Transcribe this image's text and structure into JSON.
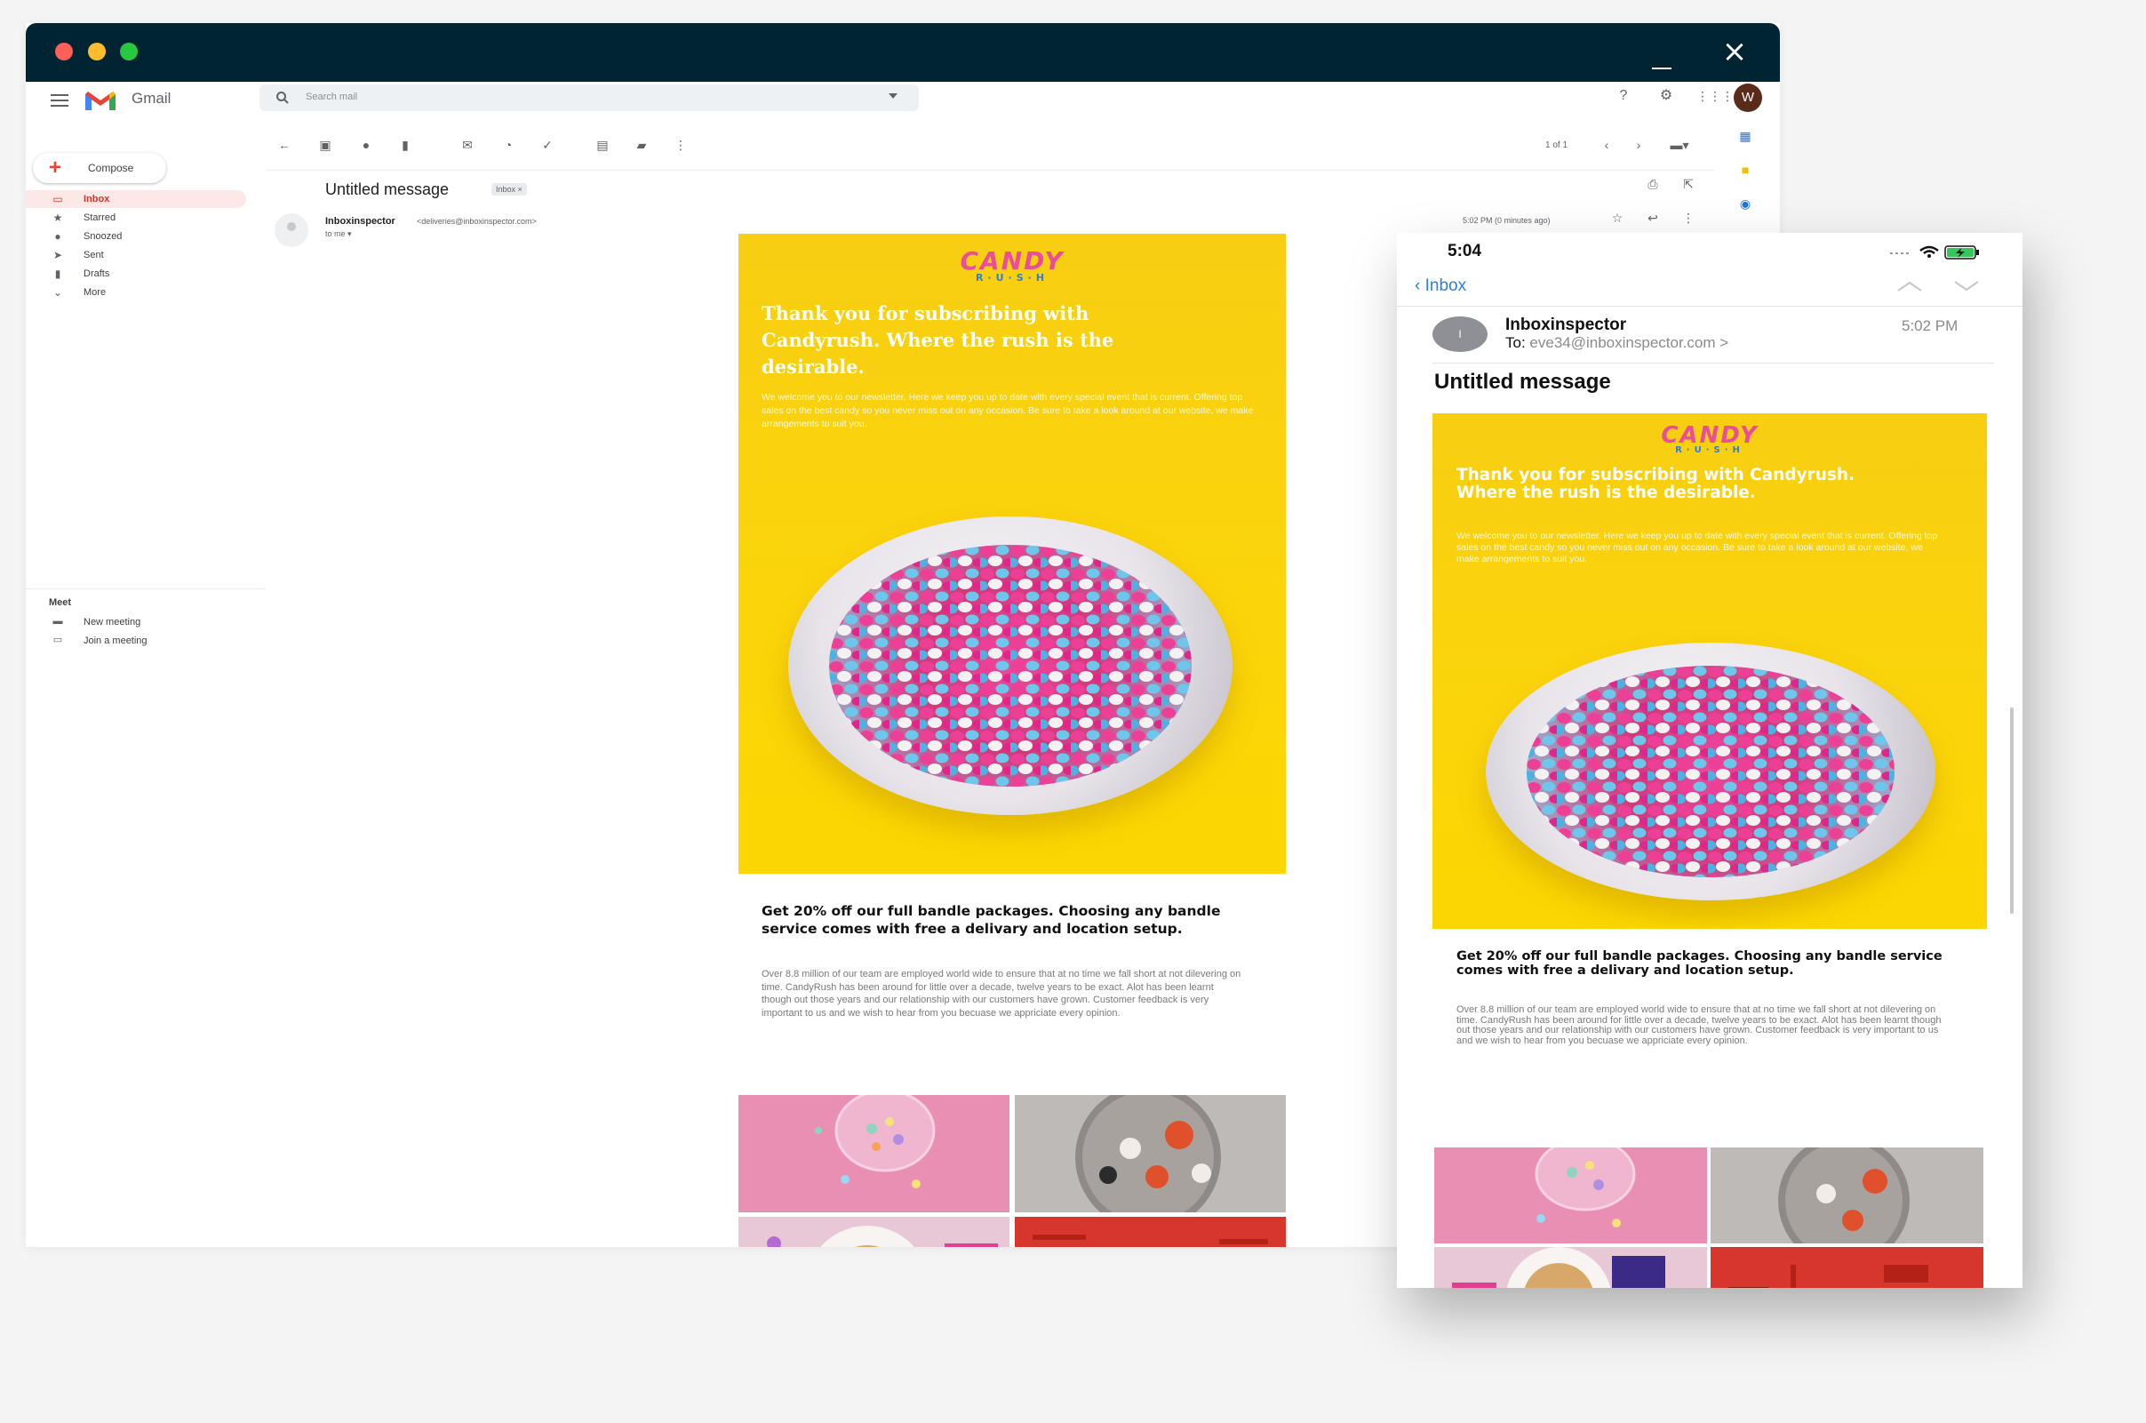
{
  "desktop": {
    "app_name": "Gmail",
    "search_placeholder": "Search mail",
    "compose_label": "Compose",
    "nav": [
      {
        "label": "Inbox",
        "icon": "inbox-icon"
      },
      {
        "label": "Starred",
        "icon": "star-icon"
      },
      {
        "label": "Snoozed",
        "icon": "clock-icon"
      },
      {
        "label": "Sent",
        "icon": "send-icon"
      },
      {
        "label": "Drafts",
        "icon": "draft-icon"
      },
      {
        "label": "More",
        "icon": "chevron-down-icon"
      }
    ],
    "meet": {
      "title": "Meet",
      "items": [
        {
          "label": "New meeting",
          "icon": "video-icon"
        },
        {
          "label": "Join a meeting",
          "icon": "keyboard-icon"
        }
      ]
    },
    "avatar_letter": "W",
    "pager": "1 of 1",
    "message": {
      "subject": "Untitled message",
      "label": "Inbox",
      "sender_name": "Inboxinspector",
      "sender_email": "<deliveries@inboxinspector.com>",
      "to": "to me",
      "time": "5:02 PM (0 minutes ago)"
    }
  },
  "newsletter": {
    "logo_main": "CANDY",
    "logo_sub": "R·U·S·H",
    "hero_title": "Thank you for subscribing with Candyrush. Where the rush is the desirable.",
    "hero_body": "We welcome you to our newsletter. Here we keep you up to date with every special event that is current. Offering top sales on the best candy so you never miss out on any occasion. Be sure to take a look around at our website, we make arrangements to suit you.",
    "offer": "Get 20% off our full bandle packages. Choosing any bandle service comes with free a delivary and location setup.",
    "paragraph": "Over 8.8 million of our team are employed world wide to ensure that at no time we fall short at not dilevering on time. CandyRush has been around for little over a decade, twelve years to be exact. Alot has been learnt though out those years and our relationship with our customers have grown. Customer feedback is very important to us and we wish to hear from you becuase we appriciate every opinion."
  },
  "phone": {
    "time": "5:04",
    "back_label": "Inbox",
    "avatar_letter": "I",
    "sender_name": "Inboxinspector",
    "to_prefix": "To:",
    "to_address": "eve34@inboxinspector.com",
    "chevron": ">",
    "time_received": "5:02 PM",
    "subject": "Untitled message"
  },
  "colors": {
    "titlebar": "#012433",
    "newsletter_yellow": "#fbd50a",
    "logo_pink": "#ea4d9a",
    "logo_blue": "#2f7ed8",
    "ios_blue": "#2f7ed8"
  }
}
